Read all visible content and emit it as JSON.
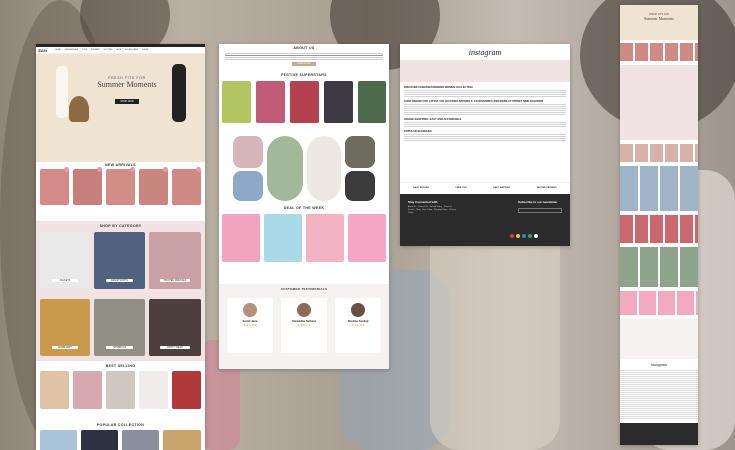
{
  "colors": {
    "accent": "#c4374f",
    "pink_bg": "#f1e3e3",
    "dark_footer": "#2b2b2b",
    "hero_bg": "#efe3d2"
  },
  "panel1": {
    "logo": "Sasi",
    "nav": [
      "HOME",
      "NEW ARRIVALS",
      "TOPS",
      "DRESSES",
      "BOTTOMS",
      "SETS",
      "ACCESSORIES",
      "CURVE",
      "BRANDS",
      "COLLECTIONS"
    ],
    "hero_line1": "FRESH FITS FOR",
    "hero_line2": "Summer Moments",
    "hero_button": "SHOP NOW",
    "new_arrivals": "NEW ARRIVALS",
    "shop_by_category": "SHOP BY CATEGORY",
    "categories": [
      "JACKETS",
      "DENIM SKIRTS",
      "PRINTED DRESSES",
      "JEWELLERY",
      "HANDBAGS",
      "PARTY WEAR"
    ],
    "best_selling": "BEST SELLING",
    "popular_collection": "POPULAR COLLECTION",
    "popular_items": [
      "SHIRTS",
      "BLAZERS",
      "TOPS",
      "DRESSES"
    ]
  },
  "panel2": {
    "about_title": "ABOUT US",
    "read_more": "READ MORE",
    "festive": "FESTIVE SUPERSTARS",
    "deal": "DEAL OF THE WEEK",
    "testimonials_title": "CUSTOMER TESTIMONIALS",
    "testimonials": [
      {
        "name": "Sarah Jane",
        "stars": "★★★★★"
      },
      {
        "name": "Shraddha Sultana",
        "stars": "★★★★★"
      },
      {
        "name": "Shobha Sankaji",
        "stars": "★★★★★"
      }
    ]
  },
  "panel3": {
    "instagram": "instagram",
    "h1": "DISCOVER FASHION-FORWARD WOMEN COLLECTION",
    "h2": "SHOP ONLINE FOR LATEST COLLECTIONS APPARELS, ACCESSORIES AND MORE AT STREET NINE FASHIONS",
    "h3": "ONLINE SHOPPING, EASY AND AFFORDABLE",
    "h4": "POPULAR SEARCHES",
    "features": [
      "EASY RETURN",
      "FREE COD",
      "FAST SHIPPING",
      "SECURE PAYMENT"
    ],
    "footer_left": "Stay Connected with",
    "footer_right": "Subscribe to our newsletter",
    "footer_links": [
      "About Us",
      "Contact Us",
      "Refund Policy",
      "Terms of Service",
      "Blog",
      "Size Guide",
      "Shipping Policy",
      "Privacy Policy"
    ]
  },
  "panel4": {
    "hero_line1": "FRESH FITS FOR",
    "hero_line2": "Summer Moments",
    "instagram": "instagram"
  }
}
